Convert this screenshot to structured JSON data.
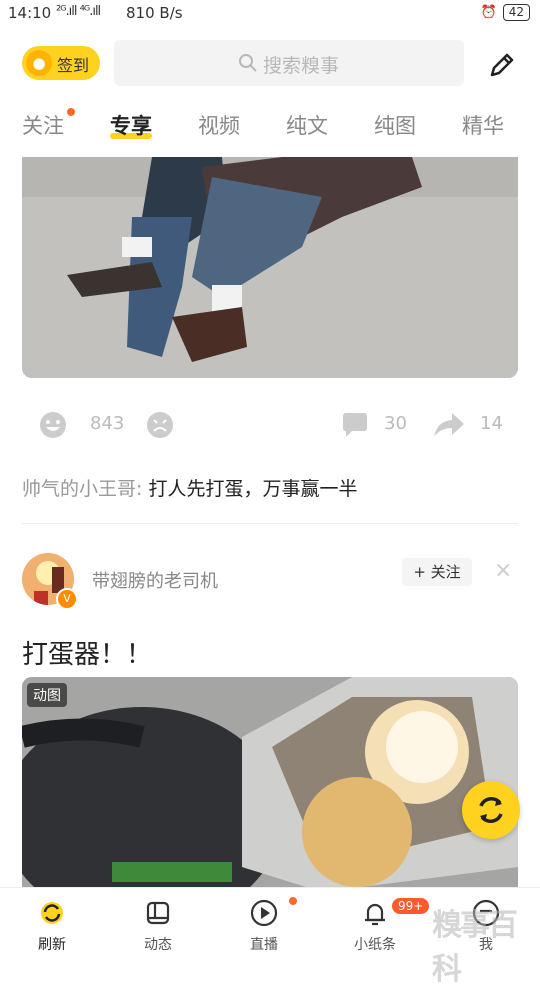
{
  "status": {
    "time": "14:10",
    "signal": "²ᴳ.ıll ⁴ᴳ.ıll",
    "speed": "810 B/s",
    "battery": "42"
  },
  "header": {
    "checkin_label": "签到",
    "search_placeholder": "搜索糗事"
  },
  "tabs": [
    {
      "label": "关注",
      "dot": true
    },
    {
      "label": "专享",
      "active": true
    },
    {
      "label": "视频"
    },
    {
      "label": "纯文"
    },
    {
      "label": "纯图"
    },
    {
      "label": "精华"
    }
  ],
  "post1": {
    "likes": "843",
    "comments": "30",
    "shares": "14",
    "hot_comment": {
      "user": "帅气的小王哥:",
      "text": "打人先打蛋，万事赢一半"
    }
  },
  "post2": {
    "author": "带翅膀的老司机",
    "follow_label": "+ 关注",
    "close": "×",
    "title": "打蛋器！！",
    "media_badge": "动图"
  },
  "bottom_nav": [
    {
      "label": "刷新",
      "icon": "refresh-icon",
      "active": true
    },
    {
      "label": "动态",
      "icon": "feed-icon"
    },
    {
      "label": "直播",
      "icon": "play-icon",
      "dot": true
    },
    {
      "label": "小纸条",
      "icon": "bell-icon",
      "badge": "99+"
    },
    {
      "label": "我",
      "icon": "profile-icon"
    }
  ],
  "watermark": "糗事百科",
  "colors": {
    "accent": "#ffd21f",
    "dot": "#ff6a2b"
  }
}
